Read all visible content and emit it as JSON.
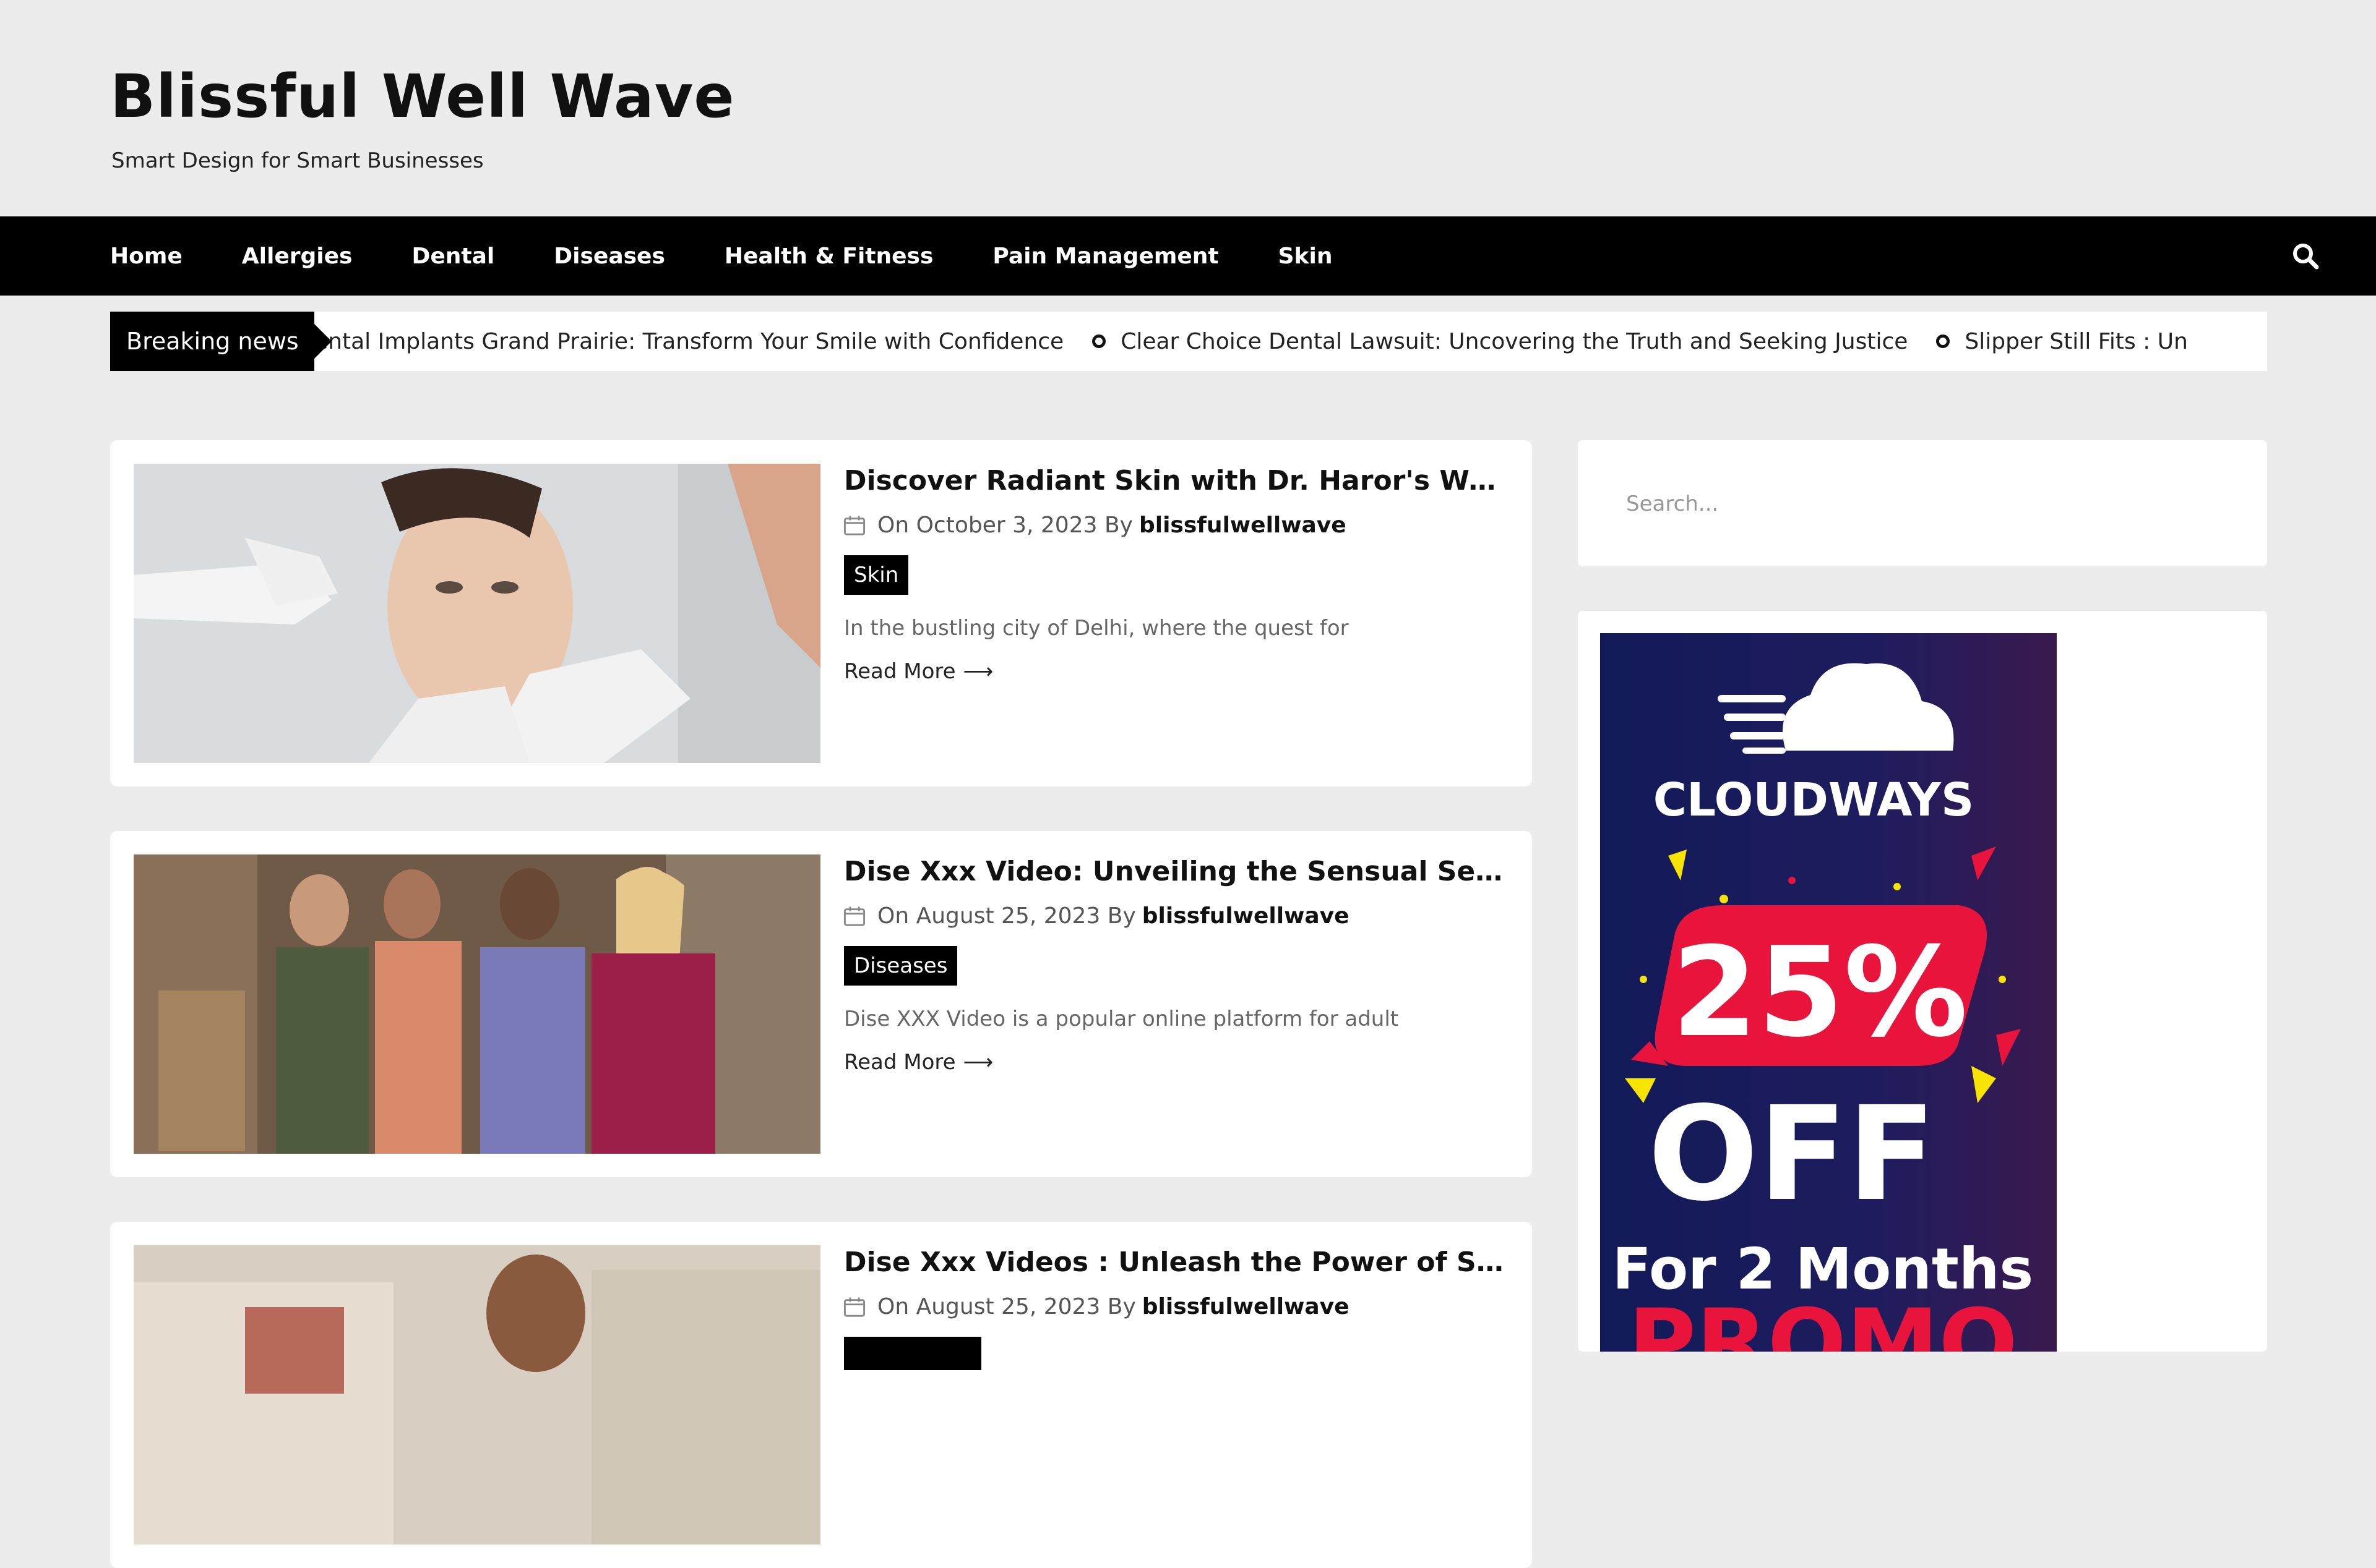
{
  "site": {
    "title": "Blissful Well Wave",
    "tagline": "Smart Design for Smart Businesses"
  },
  "nav": {
    "items": [
      "Home",
      "Allergies",
      "Dental",
      "Diseases",
      "Health & Fitness",
      "Pain Management",
      "Skin"
    ],
    "search_icon": "search-icon"
  },
  "breaking": {
    "label": "Breaking news",
    "items": [
      "ental Implants Grand Prairie: Transform Your Smile with Confidence",
      "Clear Choice Dental Lawsuit: Uncovering the Truth and Seeking Justice",
      "Slipper Still Fits : Un"
    ]
  },
  "posts": [
    {
      "title": "Discover Radiant Skin with Dr. Haror's Welln...",
      "date": "On October 3, 2023 By",
      "author": "blissfulwellwave",
      "category": "Skin",
      "excerpt": "In the bustling city of Delhi, where the quest for",
      "read_more": "Read More"
    },
    {
      "title": "Dise Xxx Video: Unveiling the Sensual Secrets",
      "date": "On August 25, 2023 By",
      "author": "blissfulwellwave",
      "category": "Diseases",
      "excerpt": "Dise XXX Video is a popular online platform for adult",
      "read_more": "Read More"
    },
    {
      "title": "Dise Xxx Videos : Unleash the Power of Sens...",
      "date": "On August 25, 2023 By",
      "author": "blissfulwellwave",
      "category": "",
      "excerpt": "",
      "read_more": ""
    }
  ],
  "sidebar": {
    "search_placeholder": "Search...",
    "ad": {
      "brand": "CLOUDWAYS",
      "discount": "25%",
      "off": "OFF",
      "duration": "For 2 Months",
      "promo": "PROMO"
    }
  },
  "colors": {
    "page_bg": "#ececec",
    "nav_bg": "#000000",
    "card_bg": "#ffffff",
    "ad_bg": "#1c1d5c",
    "ad_red": "#e8143c",
    "ad_yellow": "#f7e400"
  }
}
